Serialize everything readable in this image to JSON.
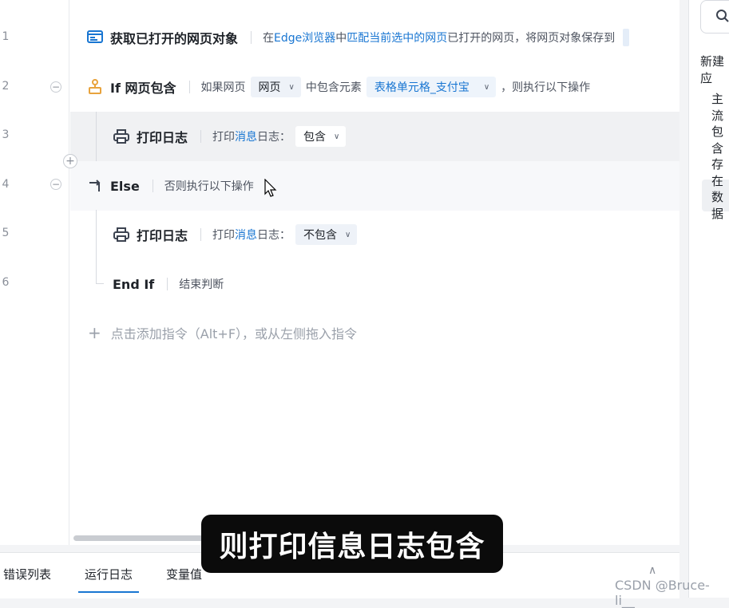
{
  "lines": {
    "numbers": [
      "1",
      "2",
      "3",
      "4",
      "5",
      "6"
    ]
  },
  "rows": {
    "r1": {
      "title": "获取已打开的网页对象",
      "desc_parts": [
        "在",
        "Edge浏览器",
        "中",
        "匹配当前选中的网页",
        "已打开的网页，将网页对象保存到"
      ]
    },
    "r2": {
      "title": "If 网页包含",
      "desc_prefix": "如果网页",
      "select1": "网页",
      "desc_mid": "中包含元素",
      "select2": "表格单元格_支付宝",
      "desc_suffix": "，则执行以下操作"
    },
    "r3": {
      "title": "打印日志",
      "desc_a": "打印",
      "desc_b": "消息",
      "desc_c": "日志：",
      "select": "包含"
    },
    "r4": {
      "title": "Else",
      "desc": "否则执行以下操作"
    },
    "r5": {
      "title": "打印日志",
      "desc_a": "打印",
      "desc_b": "消息",
      "desc_c": "日志：",
      "select": "不包含"
    },
    "r6": {
      "title": "End If",
      "desc": "结束判断"
    }
  },
  "add_hint": "点击添加指令（Alt+F），或从左侧拖入指令",
  "bottom_tabs": [
    "错误列表",
    "运行日志",
    "变量值"
  ],
  "active_bottom_tab": "运行日志",
  "right_panel": {
    "title": "新建应",
    "items": [
      "主流",
      "包含",
      "存在",
      "数据"
    ]
  },
  "subtitle": "则打印信息日志包含",
  "watermark": "CSDN @Bruce-li__",
  "colors": {
    "accent": "#1976d2",
    "icon_orange": "#e8a33d"
  }
}
